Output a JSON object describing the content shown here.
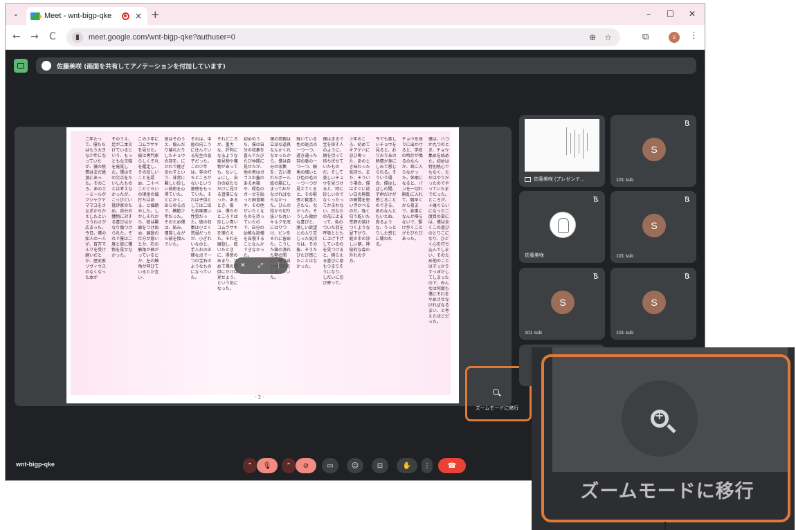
{
  "browser": {
    "tab_title": "Meet - wnt-bigp-qke",
    "tab_close": "×",
    "new_tab": "+",
    "url": "meet.google.com/wnt-bigp-qke?authuser=0",
    "profile_initial": "s",
    "nav": {
      "back": "←",
      "forward": "→",
      "reload": "C"
    },
    "window": {
      "minimize": "–",
      "maximize": "☐",
      "close": "✕"
    }
  },
  "meet": {
    "presenter_banner": "佐藤美咲 (画面を共有してアノテーションを付加しています)",
    "page_number": "- 2 -",
    "zoom_button_label": "ズームモードに移行",
    "meeting_code": "wnt-bigp-qke",
    "participants": [
      {
        "name": "佐藤美咲 (プレゼンテ...",
        "type": "presentation",
        "muted": false
      },
      {
        "name": "101 sub",
        "initial": "S",
        "muted": true
      },
      {
        "name": "佐藤美咲",
        "type": "portrait",
        "muted": true
      },
      {
        "name": "101 sub",
        "initial": "S",
        "muted": true
      },
      {
        "name": "101 sub",
        "initial": "S",
        "muted": true
      },
      {
        "name": "101 sub",
        "initial": "S",
        "muted": true
      }
    ],
    "document_columns": [
      "僕は、八つか九つのとき、チョウ集めを始めた。初めは特別熱心でもなく、ただはやりだったのでやっていたまでだった。ところが、十歳ぐらいになった二度目の夏には、僕は全くこの遊びのとりこになり、ひどく心を打ち込んでしまい、そのため他のことはすっかりすっぽかしてしまったので、みんなは何度も僕にそれをやめさせなければなるまい、と考えたほどだった。",
      "チョウを採りに出かけると、学校の時計が鳴るのなんか、耳に入らなかった。休暇になると、パンを一切れ胴乱に入れて、朝早くから夜まで、食事になんか帰らないで、駆け歩くことがたびたびあった。",
      "今でも美しいチョウを見ると、おりおりあの熱情が身にしみて感じられる。そういう場合、僕はしばしの間、子供だけが感じることのできる、あのなんともいえぬ、貪るような、うっとりした感じに襲われる。",
      "少年のころ、初めてキアゲハに忍び寄った、あのとき味わった気持ち、また、そういう場合、僕はすぐに幼い日の無数の瞬間を思い浮かべるのだ。強く匂う乾いた荒野の焼けつくような昼下がり、庭の中の涼しい朝、神秘的な森の外れの夕方。",
      "僕はまるで宝を探す人のように、網を持って待ち伏せていたものだ。そして美しいチョウを見つけると、特に珍しいのでなくったってかまわない、日なたの花に止まって、色のついた羽を呼吸とともに上げ下げしているのを見つけると、捕らえる喜びに息もつまりそうになり、しだいに忍び寄って、",
      "輝いている色の斑点の一つ一つ、透き通った羽の脈の一つ一つ、触角の細いとび色の毛の一つ一つが見えてくると、その緊張と歓喜ときたら、なかった。そうした微妙な喜びと、激しい欲望との入り交じった気持ちは、その後、そうたびたび感じたことはなかった。",
      "僕の両親は立派な道具なんかくれなかったから、僕は自分の収集を、古い潰れたボール紙の箱にしまっておかなければならなかった。びんの栓から切り抜いた丸いキルクを底にはりつけ、ピンをそれに留めた。こうした箱の潰れた壁の間に、僕は自分の宝物をしまっていた。",
      "初めのうち、僕は自分の収集を喜んでたびたび仲間に見せたが、他の者はガラスの蓋のある木箱や、緑色のガーゼを貼った飼育箱や、その他ぜいたくなものを持っていたので、自分の幼稚な設備を自慢することなんかできなかった。",
      "それどころか、重大な、評判になるような発見物や獲物があっても、ないしょにし、自分の妹たちだけに見せる習慣になった。あるとき、僕は、僕らのところでは珍しい青いコムラサキを捕らえた。それを展翅し、乾いたときに、得意のあまり、せめて隣の子供にだけは見せよう、という気になった。",
      "それは、中庭の向こうに住んでいる先生の息子だった。この少年は、非の打ちどころがないという悪徳をもっていた。それは子供としては二倍も気味悪い性質だった。彼の収集は小さく貧弱だったが、小ぎれいなのと、手入れの正確な点で一つの宝石のようなものになっていた。",
      "彼はそのうえ、傷んだり壊れたりしたチョウの羽を、にかわで継ぎ合わすという、非常に難しい珍しい技術を心得ていた。とにかく、あらゆる点で、模範少年だった。そのため僕は、妬み、嘆賞しながら彼を憎んでいた。",
      "この少年にコムラサキを見せた。彼は専門家らしくそれを鑑定し、その珍しいことを認め、二十ペニヒぐらいの現金の値打ちはある、と値踏みした。しかしそれから、彼は難癖をつけ始め、展翅の仕方が悪いとか、右の触角が曲がっているとか、左の触角が伸びているとか言い、",
      "そのうえ、足が二本欠けているという、もっともな欠陥を発見した。僕はその欠点をたいしたものとは考えなかったが、こっぴどい批評家のため、自分の獲物に対する喜びはかなり傷つけられた。それで僕は二度と彼に獲物を見せなかった。",
      "二年たって、僕たちはもう大きな少年になっていたが、僕の熱情はまだ絶頂にあった。そのころ、あのエーミールがクジャクヤママユをさなぎからかえしたといううわさが広まった。今日、僕の知人の一人が、百万マルクを受け継いだとか、歴史家リヴィウスのなくなった本が"
    ]
  }
}
